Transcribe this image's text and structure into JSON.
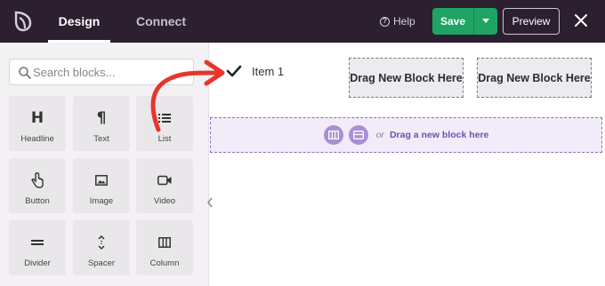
{
  "header": {
    "tabs": [
      {
        "label": "Design",
        "active": true
      },
      {
        "label": "Connect",
        "active": false
      }
    ],
    "help_label": "Help",
    "save_label": "Save",
    "preview_label": "Preview"
  },
  "sidebar": {
    "search_placeholder": "Search blocks...",
    "blocks": [
      {
        "label": "Headline",
        "icon": "heading-icon"
      },
      {
        "label": "Text",
        "icon": "paragraph-icon"
      },
      {
        "label": "List",
        "icon": "list-icon"
      },
      {
        "label": "Button",
        "icon": "pointer-icon"
      },
      {
        "label": "Image",
        "icon": "image-icon"
      },
      {
        "label": "Video",
        "icon": "video-icon"
      },
      {
        "label": "Divider",
        "icon": "divider-icon"
      },
      {
        "label": "Spacer",
        "icon": "spacer-icon"
      },
      {
        "label": "Column",
        "icon": "column-icon"
      }
    ]
  },
  "canvas": {
    "list_item": "Item 1",
    "drag_box_1": "Drag New Block Here",
    "drag_box_2": "Drag New Block Here",
    "dropzone_or": "or",
    "dropzone_text": "Drag a new block here"
  },
  "colors": {
    "topbar": "#2c1f30",
    "save": "#1fa463",
    "accent_purple": "#6f4fb2",
    "annotation_arrow": "#e8352a"
  }
}
